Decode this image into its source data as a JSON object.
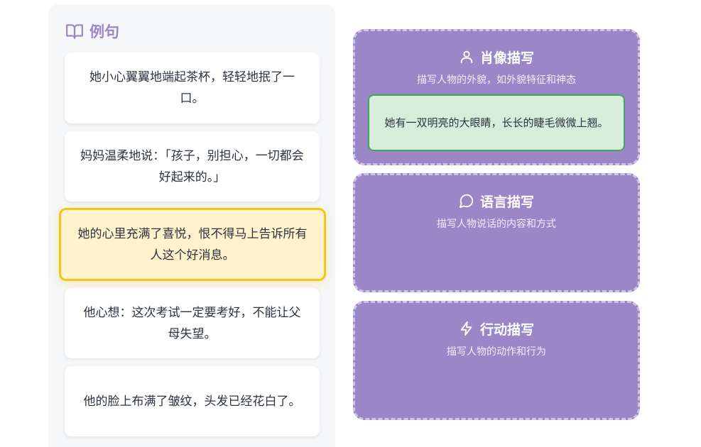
{
  "examples_panel": {
    "title": "例句",
    "icon": "book-open-icon",
    "sentences": [
      "她小心翼翼地端起茶杯，轻轻地抿了一口。",
      "妈妈温柔地说：「孩子，别担心，一切都会好起来的。」",
      "她的心里充满了喜悦，恨不得马上告诉所有人这个好消息。",
      "他心想：这次考试一定要考好，不能让父母失望。",
      "他的脸上布满了皱纹，头发已经花白了。"
    ],
    "active_index": 2
  },
  "categories": [
    {
      "title": "肖像描写",
      "icon": "user-icon",
      "description": "描写人物的外貌，如外貌特征和神态",
      "placed": [
        "她有一双明亮的大眼睛，长长的睫毛微微上翘。"
      ]
    },
    {
      "title": "语言描写",
      "icon": "speech-bubble-icon",
      "description": "描写人物说话的内容和方式",
      "placed": []
    },
    {
      "title": "行动描写",
      "icon": "lightning-icon",
      "description": "描写人物的动作和行为",
      "placed": []
    }
  ],
  "colors": {
    "accent_purple": "#9b87c7",
    "active_yellow": "#f5c518",
    "placed_green": "#3ea65a"
  }
}
